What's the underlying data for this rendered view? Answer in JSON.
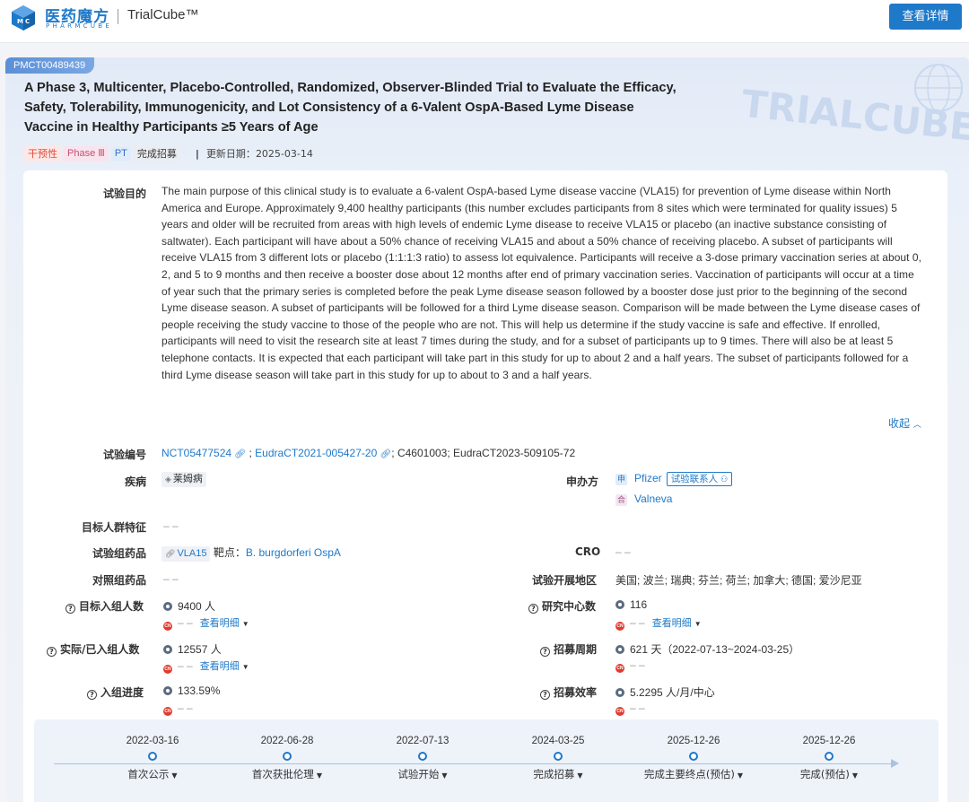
{
  "header": {
    "brand_cn": "医药魔方",
    "brand_en": "PHARMCUBE",
    "product": "TrialCube™",
    "detail_button": "查看详情"
  },
  "trial": {
    "id": "PMCT00489439",
    "title": "A Phase 3, Multicenter, Placebo-Controlled, Randomized, Observer-Blinded Trial to Evaluate the Efficacy, Safety, Tolerability, Immunogenicity, and Lot Consistency of a 6-Valent OspA-Based Lyme Disease Vaccine in Healthy Participants ≥5 Years of Age",
    "watermark": "TRIALCUBE",
    "tags": {
      "type": "干预性",
      "phase": "Phase Ⅲ",
      "pt": "PT",
      "status": "完成招募"
    },
    "update_label": "更新日期：",
    "update_date": "2025-03-14"
  },
  "purpose": {
    "label": "试验目的",
    "text": "The main purpose of this clinical study is to evaluate a 6-valent OspA-based Lyme disease vaccine (VLA15) for prevention of Lyme disease within North America and Europe. Approximately 9,400 healthy participants (this number excludes participants from 8 sites which were terminated for quality issues) 5 years and older will be recruited from areas with high levels of endemic Lyme disease to receive VLA15 or placebo (an inactive substance consisting of saltwater). Each participant will have about a 50% chance of receiving VLA15 and about a 50% chance of receiving placebo. A subset of participants will receive VLA15 from 3 different lots or placebo (1:1:1:3 ratio) to assess lot equivalence. Participants will receive a 3-dose primary vaccination series at about 0, 2, and 5 to 9 months and then receive a booster dose about 12 months after end of primary vaccination series. Vaccination of participants will occur at a time of year such that the primary series is completed before the peak Lyme disease season followed by a booster dose just prior to the beginning of the second Lyme disease season. A subset of participants will be followed for a third Lyme disease season. Comparison will be made between the Lyme disease cases of people receiving the study vaccine to those of the people who are not. This will help us determine if the study vaccine is safe and effective. If enrolled, participants will need to visit the research site at least 7 times during the study, and for a subset of participants up to 9 times. There will also be at least 5 telephone contacts. It is expected that each participant will take part in this study for up to about 2 and a half years. The subset of participants followed for a third Lyme disease season will take part in this study for up to about to 3 and a half years.",
    "collapse": "收起"
  },
  "fields": {
    "trial_no_label": "试验编号",
    "trial_no_1": "NCT05477524",
    "trial_no_2": "EudraCT2021-005427-20",
    "trial_no_rest": "; C4601003; EudraCT2023-509105-72",
    "disease_label": "疾病",
    "disease": "莱姆病",
    "sponsor_label": "申办方",
    "sponsor_1_tag": "申",
    "sponsor_1": "Pfizer",
    "contact": "试验联系人",
    "sponsor_2_tag": "合",
    "sponsor_2": "Valneva",
    "target_pop_label": "目标人群特征",
    "target_pop": "– –",
    "drug_label": "试验组药品",
    "drug": "VLA15",
    "target_label": "靶点：",
    "target": "B. burgdorferi OspA",
    "cro_label": "CRO",
    "cro": "– –",
    "control_label": "对照组药品",
    "control": "– –",
    "region_label": "试验开展地区",
    "region": "美国; 波兰; 瑞典; 芬兰; 荷兰; 加拿大; 德国; 爱沙尼亚",
    "target_enroll_label": "目标入组人数",
    "target_enroll": "9400 人",
    "target_enroll_cn": "– –",
    "view_more": "查看明细",
    "centers_label": "研究中心数",
    "centers": "116",
    "centers_cn": "– –",
    "actual_enroll_label": "实际/已入组人数",
    "actual_enroll": "12557 人",
    "actual_enroll_cn": "– –",
    "recruit_period_label": "招募周期",
    "recruit_period": "621 天（2022-07-13~2024-03-25）",
    "recruit_period_cn": "– –",
    "progress_label": "入组进度",
    "progress": "133.59%",
    "progress_cn": "– –",
    "efficiency_label": "招募效率",
    "efficiency": "5.2295 人/月/中心",
    "efficiency_cn": "– –",
    "cn_badge": "CN"
  },
  "timeline": [
    {
      "date": "2022-03-16",
      "label": "首次公示"
    },
    {
      "date": "2022-06-28",
      "label": "首次获批伦理"
    },
    {
      "date": "2022-07-13",
      "label": "试验开始"
    },
    {
      "date": "2024-03-25",
      "label": "完成招募"
    },
    {
      "date": "2025-12-26",
      "label": "完成主要终点(预估)"
    },
    {
      "date": "2025-12-26",
      "label": "完成(预估)"
    }
  ],
  "colors": {
    "accent": "#1f79c9",
    "tag_red": "#e14b3b",
    "cn_red": "#e23a2e"
  }
}
